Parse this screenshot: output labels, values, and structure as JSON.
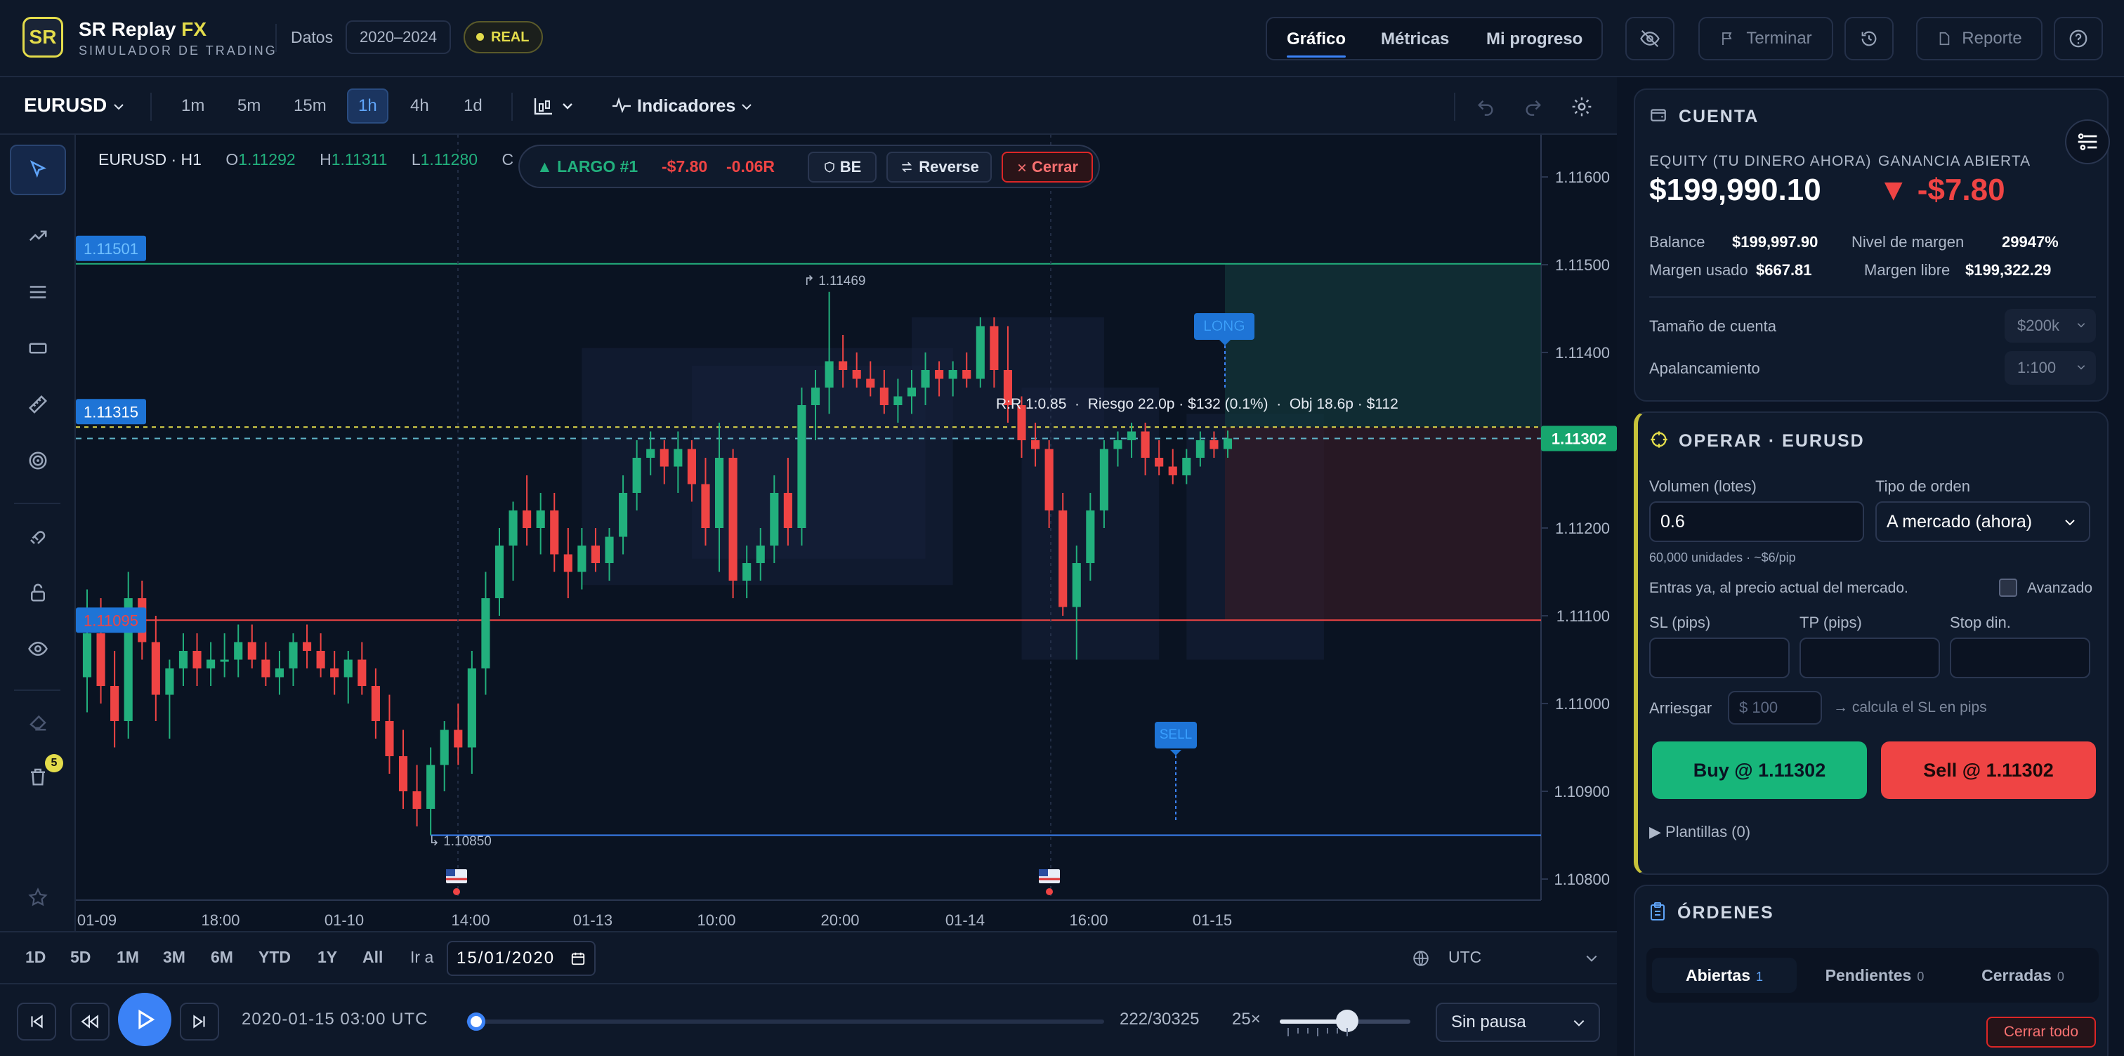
{
  "header": {
    "logo_text": "SR",
    "brand_name": "SR Replay",
    "brand_fx": "FX",
    "brand_sub": "SIMULADOR DE TRADING",
    "datos_label": "Datos",
    "datos_range": "2020–2024",
    "mode_badge": "REAL",
    "nav_tabs": [
      "Gráfico",
      "Métricas",
      "Mi progreso"
    ],
    "terminar_label": "Terminar",
    "reporte_label": "Reporte"
  },
  "chart_toolbar": {
    "symbol": "EURUSD",
    "timeframes": [
      "1m",
      "5m",
      "15m",
      "1h",
      "4h",
      "1d"
    ],
    "active_timeframe": "1h",
    "indicators_label": "Indicadores"
  },
  "left_tools": {
    "trash_badge": "5"
  },
  "ohlc": {
    "symbol_tf": "EURUSD · H1",
    "o_label": "O",
    "o": "1.11292",
    "h_label": "H",
    "h": "1.11311",
    "l_label": "L",
    "l": "1.11280",
    "c_label": "C"
  },
  "position_bar": {
    "label": "▲ LARGO #1",
    "pnl": "-$7.80",
    "r": "-0.06R",
    "be": "BE",
    "reverse": "Reverse",
    "close": "Cerrar"
  },
  "chart_data": {
    "type": "candlestick",
    "symbol": "EURUSD",
    "timeframe": "H1",
    "ylim": [
      1.1075,
      1.1166
    ],
    "y_ticks": [
      "1.11600",
      "1.11500",
      "1.11400",
      "1.11300",
      "1.11200",
      "1.11100",
      "1.11000",
      "1.10900",
      "1.10800"
    ],
    "x_ticks": [
      "01-09",
      "18:00",
      "01-10",
      "14:00",
      "01-13",
      "10:00",
      "20:00",
      "01-14",
      "16:00",
      "01-15"
    ],
    "current_price": "1.11302",
    "level_labels": {
      "tp": "1.11501",
      "entry": "1.11315",
      "sl": "1.11095",
      "swing_high": "1.11469",
      "swing_low": "1.10850"
    },
    "levels": {
      "tp": 1.11501,
      "entry": 1.11315,
      "sl": 1.11095,
      "current": 1.11302,
      "swing_high": 1.11469,
      "swing_low": 1.1085
    },
    "rr_text": "R:R 1:0.85  ·  Riesgo 22.0p · $132 (0.1%)  ·  Obj 18.6p · $112",
    "long_tag": "LONG",
    "sell_tag": "SELL",
    "candles": [
      [
        1.1103,
        1.1113,
        1.1099,
        1.1108
      ],
      [
        1.1108,
        1.1112,
        1.11,
        1.1102
      ],
      [
        1.1102,
        1.1106,
        1.1095,
        1.1098
      ],
      [
        1.1098,
        1.1115,
        1.1096,
        1.1112
      ],
      [
        1.1112,
        1.1114,
        1.1105,
        1.1107
      ],
      [
        1.1107,
        1.111,
        1.1098,
        1.1101
      ],
      [
        1.1101,
        1.1105,
        1.1096,
        1.1104
      ],
      [
        1.1104,
        1.1108,
        1.1102,
        1.1106
      ],
      [
        1.1106,
        1.1108,
        1.1102,
        1.1104
      ],
      [
        1.1104,
        1.1107,
        1.1102,
        1.1105
      ],
      [
        1.1105,
        1.1108,
        1.1103,
        1.1105
      ],
      [
        1.1105,
        1.1109,
        1.1103,
        1.1107
      ],
      [
        1.1107,
        1.1109,
        1.1104,
        1.1105
      ],
      [
        1.1105,
        1.1107,
        1.1102,
        1.1103
      ],
      [
        1.1103,
        1.1106,
        1.1101,
        1.1104
      ],
      [
        1.1104,
        1.1108,
        1.1102,
        1.1107
      ],
      [
        1.1107,
        1.1109,
        1.1104,
        1.1106
      ],
      [
        1.1106,
        1.1108,
        1.1103,
        1.1104
      ],
      [
        1.1104,
        1.1106,
        1.1101,
        1.1103
      ],
      [
        1.1103,
        1.1106,
        1.11,
        1.1105
      ],
      [
        1.1105,
        1.1107,
        1.1101,
        1.1102
      ],
      [
        1.1102,
        1.1104,
        1.1096,
        1.1098
      ],
      [
        1.1098,
        1.1101,
        1.1092,
        1.1094
      ],
      [
        1.1094,
        1.1097,
        1.1088,
        1.109
      ],
      [
        1.109,
        1.1093,
        1.1086,
        1.1088
      ],
      [
        1.1088,
        1.1095,
        1.1085,
        1.1093
      ],
      [
        1.1093,
        1.1098,
        1.109,
        1.1097
      ],
      [
        1.1097,
        1.11,
        1.1093,
        1.1095
      ],
      [
        1.1095,
        1.1106,
        1.1092,
        1.1104
      ],
      [
        1.1104,
        1.1115,
        1.1101,
        1.1112
      ],
      [
        1.1112,
        1.112,
        1.111,
        1.1118
      ],
      [
        1.1118,
        1.1123,
        1.1114,
        1.1122
      ],
      [
        1.1122,
        1.1126,
        1.1118,
        1.112
      ],
      [
        1.112,
        1.1124,
        1.1117,
        1.1122
      ],
      [
        1.1122,
        1.1124,
        1.1115,
        1.1117
      ],
      [
        1.1117,
        1.112,
        1.1112,
        1.1115
      ],
      [
        1.1115,
        1.112,
        1.1113,
        1.1118
      ],
      [
        1.1118,
        1.112,
        1.1115,
        1.1116
      ],
      [
        1.1116,
        1.112,
        1.1114,
        1.1119
      ],
      [
        1.1119,
        1.1126,
        1.1117,
        1.1124
      ],
      [
        1.1124,
        1.113,
        1.1122,
        1.1128
      ],
      [
        1.1128,
        1.1131,
        1.1126,
        1.1129
      ],
      [
        1.1129,
        1.113,
        1.1125,
        1.1127
      ],
      [
        1.1127,
        1.1131,
        1.1124,
        1.1129
      ],
      [
        1.1129,
        1.113,
        1.1123,
        1.1125
      ],
      [
        1.1125,
        1.1128,
        1.1118,
        1.112
      ],
      [
        1.112,
        1.1132,
        1.1115,
        1.1128
      ],
      [
        1.1128,
        1.1129,
        1.1112,
        1.1114
      ],
      [
        1.1114,
        1.1118,
        1.1112,
        1.1116
      ],
      [
        1.1116,
        1.112,
        1.1114,
        1.1118
      ],
      [
        1.1118,
        1.1126,
        1.1116,
        1.1124
      ],
      [
        1.1124,
        1.1128,
        1.1118,
        1.112
      ],
      [
        1.112,
        1.1136,
        1.1118,
        1.1134
      ],
      [
        1.1134,
        1.1138,
        1.113,
        1.1136
      ],
      [
        1.1136,
        1.11469,
        1.1133,
        1.1139
      ],
      [
        1.1139,
        1.1142,
        1.1136,
        1.1138
      ],
      [
        1.1138,
        1.114,
        1.1136,
        1.1137
      ],
      [
        1.1137,
        1.1139,
        1.1135,
        1.1136
      ],
      [
        1.1136,
        1.1138,
        1.1133,
        1.1134
      ],
      [
        1.1134,
        1.1137,
        1.1132,
        1.1135
      ],
      [
        1.1135,
        1.1138,
        1.1133,
        1.1136
      ],
      [
        1.1136,
        1.114,
        1.1134,
        1.1138
      ],
      [
        1.1138,
        1.1139,
        1.1135,
        1.1137
      ],
      [
        1.1137,
        1.1139,
        1.1135,
        1.1138
      ],
      [
        1.1138,
        1.114,
        1.1136,
        1.1137
      ],
      [
        1.1137,
        1.1144,
        1.1136,
        1.1143
      ],
      [
        1.1143,
        1.1144,
        1.1136,
        1.1138
      ],
      [
        1.1138,
        1.1143,
        1.1132,
        1.1134
      ],
      [
        1.1134,
        1.1135,
        1.1128,
        1.113
      ],
      [
        1.113,
        1.1132,
        1.1127,
        1.1129
      ],
      [
        1.1129,
        1.113,
        1.112,
        1.1122
      ],
      [
        1.1122,
        1.1124,
        1.111,
        1.1111
      ],
      [
        1.1111,
        1.1118,
        1.1105,
        1.1116
      ],
      [
        1.1116,
        1.1124,
        1.1114,
        1.1122
      ],
      [
        1.1122,
        1.113,
        1.112,
        1.1129
      ],
      [
        1.1129,
        1.1131,
        1.1127,
        1.113
      ],
      [
        1.113,
        1.1132,
        1.1128,
        1.1131
      ],
      [
        1.1131,
        1.1132,
        1.1126,
        1.1128
      ],
      [
        1.1128,
        1.113,
        1.1126,
        1.1127
      ],
      [
        1.1127,
        1.1129,
        1.1125,
        1.1126
      ],
      [
        1.1126,
        1.1129,
        1.1125,
        1.1128
      ],
      [
        1.1128,
        1.1131,
        1.1127,
        1.113
      ],
      [
        1.113,
        1.1131,
        1.1128,
        1.1129
      ],
      [
        1.1129,
        1.11311,
        1.1128,
        1.11302
      ]
    ]
  },
  "range_bar": {
    "ranges": [
      "1D",
      "5D",
      "1M",
      "3M",
      "6M",
      "YTD",
      "1Y",
      "All"
    ],
    "goto_label": "Ir a",
    "goto_date": "15/01/2020",
    "timezone": "UTC"
  },
  "playback": {
    "timestamp": "2020-01-15 03:00 UTC",
    "progress": 0.0073,
    "counter": "222/30325",
    "speed": "25×",
    "speed_level": 0.45,
    "pause_mode": "Sin pausa"
  },
  "account": {
    "title": "CUENTA",
    "equity_label": "EQUITY (TU DINERO AHORA)",
    "equity": "$199,990.10",
    "open_pnl_label": "GANANCIA ABIERTA",
    "open_pnl": "▼ -$7.80",
    "balance_label": "Balance",
    "balance": "$199,997.90",
    "margin_level_label": "Nivel de margen",
    "margin_level": "29947%",
    "margin_used_label": "Margen usado",
    "margin_used": "$667.81",
    "free_margin_label": "Margen libre",
    "free_margin": "$199,322.29",
    "account_size_label": "Tamaño de cuenta",
    "account_size": "$200k",
    "leverage_label": "Apalancamiento",
    "leverage": "1:100"
  },
  "trade": {
    "title": "OPERAR · EURUSD",
    "volume_label": "Volumen (lotes)",
    "volume": "0.6",
    "order_type_label": "Tipo de orden",
    "order_type": "A mercado (ahora)",
    "units_hint": "60,000 unidades · ~$6/pip",
    "market_hint": "Entras ya, al precio actual del mercado.",
    "advanced_label": "Avanzado",
    "sl_label": "SL (pips)",
    "tp_label": "TP (pips)",
    "stop_label": "Stop din.",
    "risk_label": "Arriesgar",
    "risk_placeholder": "$ 100",
    "risk_hint": "→ calcula el SL en pips",
    "buy_label": "Buy @ 1.11302",
    "sell_label": "Sell @ 1.11302",
    "templates_label": "▶ Plantillas (0)"
  },
  "orders": {
    "title": "ÓRDENES",
    "tabs": [
      {
        "label": "Abiertas",
        "count": "1"
      },
      {
        "label": "Pendientes",
        "count": "0"
      },
      {
        "label": "Cerradas",
        "count": "0"
      }
    ],
    "close_all": "Cerrar todo"
  },
  "colors": {
    "bull": "#22b07d",
    "bear": "#ef4444",
    "accent": "#3b82f6",
    "brand": "#e3dc4b"
  }
}
